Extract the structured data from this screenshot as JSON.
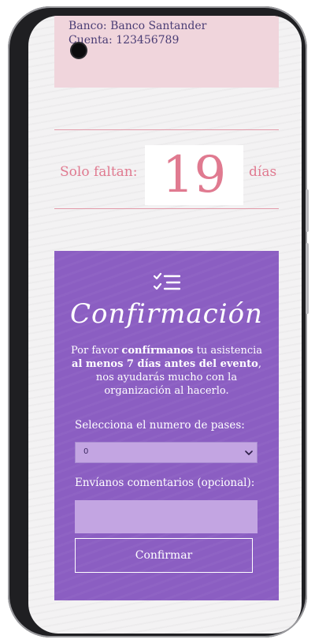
{
  "bank": {
    "bank_label": "Banco:",
    "bank_value": "Banco Santander",
    "account_label": "Cuenta:",
    "account_value": "123456789"
  },
  "countdown": {
    "prefix": "Solo faltan:",
    "number": "19",
    "suffix": "días"
  },
  "rsvp": {
    "icon": "checklist-icon",
    "title": "Confirmación",
    "text_1": "Por favor ",
    "text_bold_1": "confírmanos",
    "text_2": " tu asistencia ",
    "text_bold_2": "al menos 7 días antes del evento",
    "text_3": ", nos ayudarás mucho con la organización al hacerlo.",
    "passes_label": "Selecciona el numero de pases:",
    "passes_value": "0",
    "comments_label": "Envíanos comentarios (opcional):",
    "comments_value": "",
    "submit_label": "Confirmar"
  },
  "colors": {
    "accent_pink": "#e07a90",
    "card_pink": "#f0d5dc",
    "rsvp_purple": "#8b5ec2",
    "field_lilac": "#c3a5e2"
  }
}
